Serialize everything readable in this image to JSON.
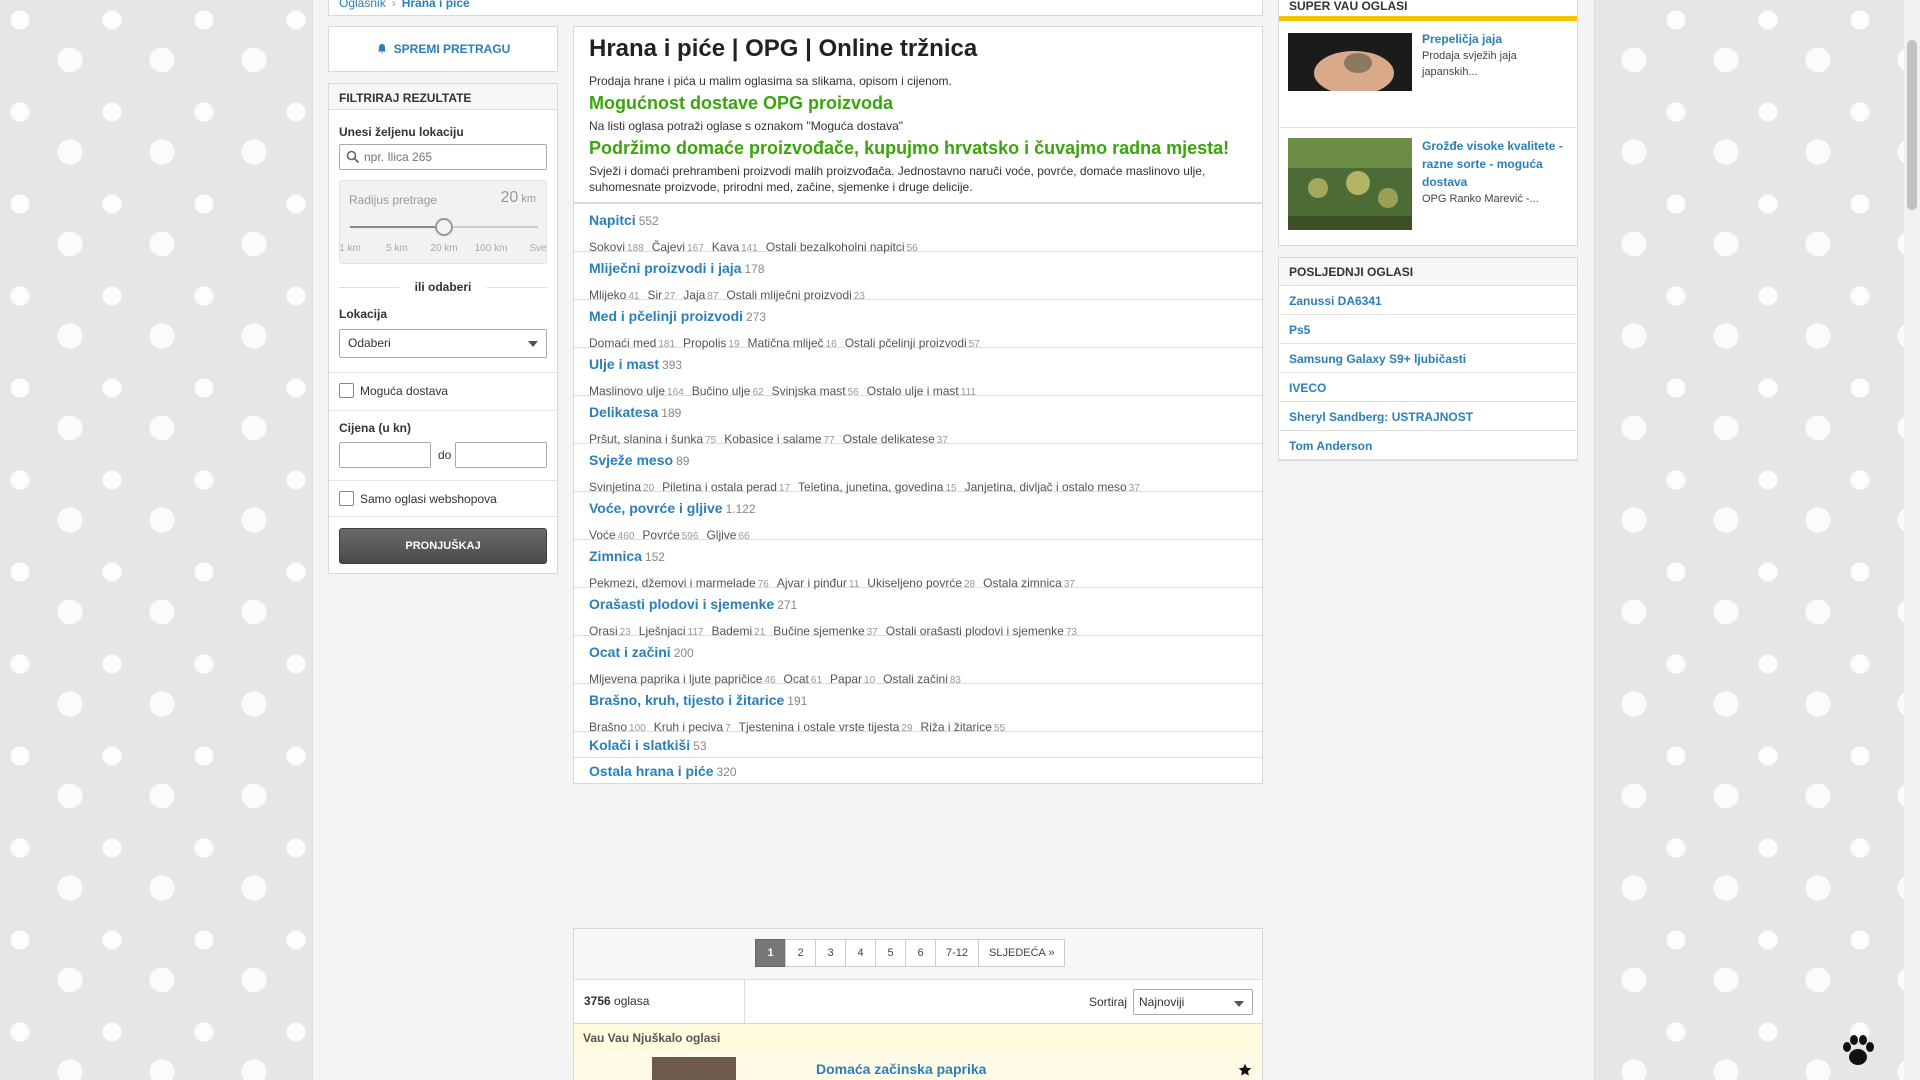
{
  "breadcrumb": {
    "root": "Oglasnik",
    "current": "Hrana i piće"
  },
  "sidebar": {
    "save_search": "SPREMI PRETRAGU",
    "filter_title": "FILTRIRAJ REZULTATE",
    "location_label": "Unesi željenu lokaciju",
    "location_placeholder": "npr. Ilica 265",
    "radius_label": "Radijus pretrage",
    "radius_value": "20",
    "radius_unit": "km",
    "radius_ticks": [
      "1 km",
      "5 km",
      "20 km",
      "100 km",
      "Sve"
    ],
    "radius_position": 0.5,
    "or_select": "ili odaberi",
    "lokacija_label": "Lokacija",
    "lokacija_value": "Odaberi",
    "delivery_checkbox": "Moguća dostava",
    "price_label": "Cijena (u kn)",
    "price_to": "do",
    "webshop_checkbox": "Samo oglasi webshopova",
    "submit": "PRONJUŠKAJ"
  },
  "main": {
    "title": "Hrana i piće | OPG | Online tržnica",
    "intro": "Prodaja hrane i pića u malim oglasima sa slikama, opisom i cijenom.",
    "green1": "Mogućnost dostave OPG proizvoda",
    "note": "Na listi oglasa potraži oglase s oznakom \"Moguća dostava\"",
    "green2": "Podržimo domaće proizvođače, kupujmo hrvatsko i čuvajmo radna mjesta!",
    "desc": "Svježi i domaći prehrambeni proizvodi malih proizvođača. Jednostavno naruči voće, povrće, domaće maslinovo ulje, suhomesnate proizvode, prirodni med, začine, sjemenke i druge delicije."
  },
  "categories": [
    {
      "name": "Napitci",
      "count": "552",
      "subs": [
        [
          "Sokovi",
          "188"
        ],
        [
          "Čajevi",
          "167"
        ],
        [
          "Kava",
          "141"
        ],
        [
          "Ostali bezalkoholni napitci",
          "56"
        ]
      ]
    },
    {
      "name": "Mliječni proizvodi i jaja",
      "count": "178",
      "subs": [
        [
          "Mlijeko",
          "41"
        ],
        [
          "Sir",
          "27"
        ],
        [
          "Jaja",
          "87"
        ],
        [
          "Ostali mliječni proizvodi",
          "23"
        ]
      ]
    },
    {
      "name": "Med i pčelinji proizvodi",
      "count": "273",
      "subs": [
        [
          "Domaći med",
          "181"
        ],
        [
          "Propolis",
          "19"
        ],
        [
          "Matična mliječ",
          "16"
        ],
        [
          "Ostali pčelinji proizvodi",
          "57"
        ]
      ]
    },
    {
      "name": "Ulje i mast",
      "count": "393",
      "subs": [
        [
          "Maslinovo ulje",
          "164"
        ],
        [
          "Bučino ulje",
          "62"
        ],
        [
          "Svinjska mast",
          "56"
        ],
        [
          "Ostalo ulje i mast",
          "111"
        ]
      ]
    },
    {
      "name": "Delikatesa",
      "count": "189",
      "subs": [
        [
          "Pršut, slanina i šunka",
          "75"
        ],
        [
          "Kobasice i salame",
          "77"
        ],
        [
          "Ostale delikatese",
          "37"
        ]
      ]
    },
    {
      "name": "Svježe meso",
      "count": "89",
      "subs": [
        [
          "Svinjetina",
          "20"
        ],
        [
          "Piletina i ostala perad",
          "17"
        ],
        [
          "Teletina, junetina, govedina",
          "15"
        ],
        [
          "Janjetina, divljač i ostalo meso",
          "37"
        ]
      ]
    },
    {
      "name": "Voće, povrće i gljive",
      "count": "1.122",
      "subs": [
        [
          "Voće",
          "460"
        ],
        [
          "Povrće",
          "596"
        ],
        [
          "Gljive",
          "66"
        ]
      ]
    },
    {
      "name": "Zimnica",
      "count": "152",
      "subs": [
        [
          "Pekmezi, džemovi i marmelade",
          "76"
        ],
        [
          "Ajvar i pinđur",
          "11"
        ],
        [
          "Ukiseljeno povrće",
          "28"
        ],
        [
          "Ostala zimnica",
          "37"
        ]
      ]
    },
    {
      "name": "Orašasti plodovi i sjemenke",
      "count": "271",
      "subs": [
        [
          "Orasi",
          "23"
        ],
        [
          "Lješnjaci",
          "117"
        ],
        [
          "Bademi",
          "21"
        ],
        [
          "Bučine sjemenke",
          "37"
        ],
        [
          "Ostali orašasti plodovi i sjemenke",
          "73"
        ]
      ]
    },
    {
      "name": "Ocat i začini",
      "count": "200",
      "subs": [
        [
          "Mljevena paprika i ljute papričice",
          "46"
        ],
        [
          "Ocat",
          "61"
        ],
        [
          "Papar",
          "10"
        ],
        [
          "Ostali začini",
          "83"
        ]
      ]
    },
    {
      "name": "Brašno, kruh, tijesto i žitarice",
      "count": "191",
      "subs": [
        [
          "Brašno",
          "100"
        ],
        [
          "Kruh i peciva",
          "7"
        ],
        [
          "Tjestenina i ostale vrste tijesta",
          "29"
        ],
        [
          "Riža i žitarice",
          "55"
        ]
      ]
    },
    {
      "name": "Kolači i slatkiši",
      "count": "53",
      "subs": []
    },
    {
      "name": "Ostala hrana i piće",
      "count": "320",
      "subs": []
    }
  ],
  "pager": {
    "pages": [
      "1",
      "2",
      "3",
      "4",
      "5",
      "6",
      "7-12",
      "SLJEDEĆA »"
    ],
    "active": "1"
  },
  "results": {
    "count": "3756",
    "count_suffix": "oglasa",
    "sort_label": "Sortiraj",
    "sort_value": "Najnoviji"
  },
  "vau_strip": "Vau Vau Njuškalo oglasi",
  "first_ad": {
    "title": "Domaća začinska paprika"
  },
  "super_ads": {
    "title": "SUPER VAU OGLASI",
    "items": [
      {
        "title": "Prepeličja jaja",
        "desc": "Prodaja svježih jaja japanskih..."
      },
      {
        "title": "Grožđe visoke kvalitete - razne sorte - moguća dostava",
        "desc": "OPG Ranko Marević -..."
      }
    ]
  },
  "latest": {
    "title": "POSLJEDNJI OGLASI",
    "items": [
      "Zanussi DA6341",
      "Ps5",
      "Samsung Galaxy S9+ ljubičasti",
      "IVECO",
      "Sheryl Sandberg: USTRAJNOST",
      "Tom Anderson"
    ]
  },
  "colors": {
    "link": "#2a7fb8",
    "green": "#3ba50c",
    "accent_yellow": "#f5c400"
  }
}
